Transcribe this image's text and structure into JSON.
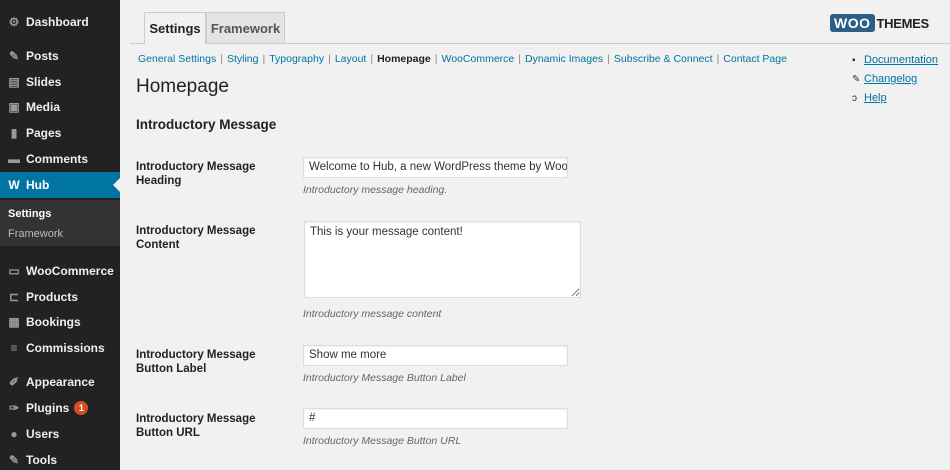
{
  "sidebar": {
    "items": [
      {
        "label": "Dashboard",
        "icon": "dashboard-icon",
        "glyph": "⚙"
      },
      {
        "label": "Posts",
        "icon": "pin-icon",
        "glyph": "✎"
      },
      {
        "label": "Slides",
        "icon": "slides-icon",
        "glyph": "▤"
      },
      {
        "label": "Media",
        "icon": "media-icon",
        "glyph": "▣"
      },
      {
        "label": "Pages",
        "icon": "pages-icon",
        "glyph": "▮"
      },
      {
        "label": "Comments",
        "icon": "comments-icon",
        "glyph": "▬"
      },
      {
        "label": "Hub",
        "icon": "hub-icon",
        "glyph": "W"
      },
      {
        "label": "WooCommerce",
        "icon": "woocommerce-icon",
        "glyph": "▭"
      },
      {
        "label": "Products",
        "icon": "cart-icon",
        "glyph": "⊏"
      },
      {
        "label": "Bookings",
        "icon": "calendar-icon",
        "glyph": "▦"
      },
      {
        "label": "Commissions",
        "icon": "commissions-icon",
        "glyph": "≡"
      },
      {
        "label": "Appearance",
        "icon": "brush-icon",
        "glyph": "✐"
      },
      {
        "label": "Plugins",
        "icon": "plugin-icon",
        "glyph": "✑",
        "badge": "1"
      },
      {
        "label": "Users",
        "icon": "user-icon",
        "glyph": "●"
      },
      {
        "label": "Tools",
        "icon": "wrench-icon",
        "glyph": "✎"
      }
    ],
    "submenu": [
      "Settings",
      "Framework"
    ]
  },
  "tabs": [
    "Settings",
    "Framework"
  ],
  "logo": {
    "woo": "WOO",
    "themes": "THEMES",
    "brand_color": "#2c5e86"
  },
  "subnav": [
    "General Settings",
    "Styling",
    "Typography",
    "Layout",
    "Homepage",
    "WooCommerce",
    "Dynamic Images",
    "Subscribe & Connect",
    "Contact Page"
  ],
  "help_links": [
    {
      "label": "Documentation",
      "icon": "document-icon",
      "glyph": "▪"
    },
    {
      "label": "Changelog",
      "icon": "wrench-icon",
      "glyph": "✎"
    },
    {
      "label": "Help",
      "icon": "help-icon",
      "glyph": "ↄ"
    }
  ],
  "page_title": "Homepage",
  "section_title": "Introductory Message",
  "fields": [
    {
      "label": "Introductory Message Heading",
      "value": "Welcome to Hub, a new WordPress theme by WooT",
      "desc": "Introductory message heading."
    },
    {
      "label": "Introductory Message Content",
      "value": "This is your message content!",
      "desc": "Introductory message content"
    },
    {
      "label": "Introductory Message Button Label",
      "value": "Show me more",
      "desc": "Introductory Message Button Label"
    },
    {
      "label": "Introductory Message Button URL",
      "value": "#",
      "desc": "Introductory Message Button URL"
    }
  ],
  "colors": {
    "sidebar_bg": "#222222",
    "accent": "#0074a2",
    "badge": "#d54e21"
  }
}
